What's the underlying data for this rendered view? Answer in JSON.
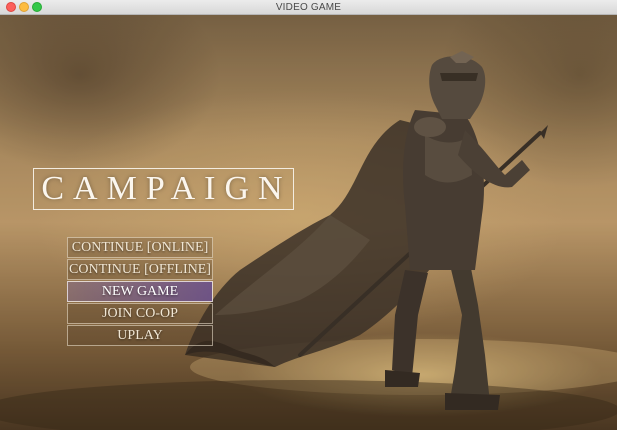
{
  "window": {
    "title": "VIDEO GAME"
  },
  "campaign": {
    "title": "CAMPAIGN"
  },
  "menu": {
    "items": [
      {
        "label": "CONTINUE [ONLINE]",
        "selected": false
      },
      {
        "label": "CONTINUE [OFFLINE]",
        "selected": false
      },
      {
        "label": "NEW GAME",
        "selected": true
      },
      {
        "label": "JOIN CO-OP",
        "selected": false
      },
      {
        "label": "UPLAY",
        "selected": false
      }
    ]
  },
  "colors": {
    "close": "#fc605c",
    "minimize": "#fdbc40",
    "maximize": "#34c84a",
    "menu_selected": "#5f4696",
    "title_text": "#fbf6ee"
  }
}
